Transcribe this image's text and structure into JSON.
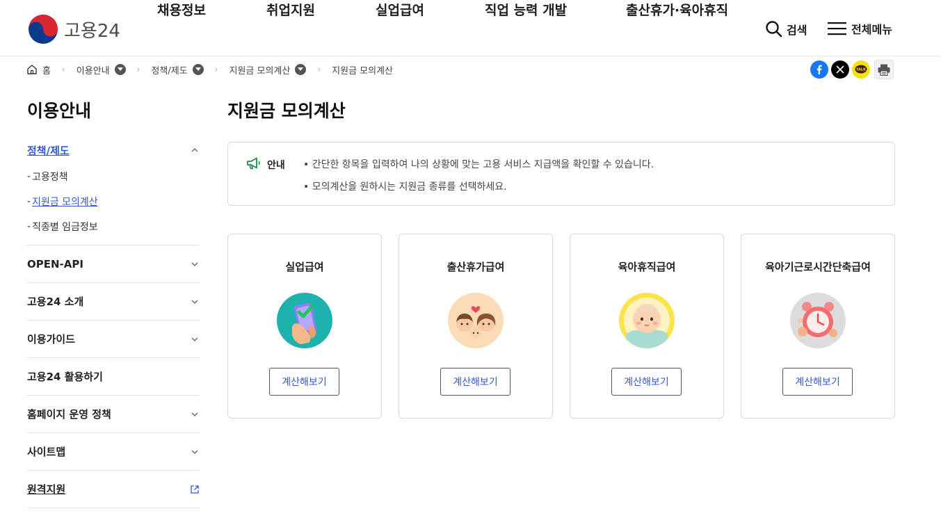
{
  "header": {
    "logo_text": "고용24",
    "nav": [
      "채용정보",
      "취업지원",
      "실업급여",
      "직업 능력 개발",
      "출산휴가·육아휴직"
    ],
    "search_label": "검색",
    "menu_label": "전체메뉴"
  },
  "breadcrumb": {
    "home": "홈",
    "items": [
      "이용안내",
      "정책/제도",
      "지원금 모의계산",
      "지원금 모의계산"
    ]
  },
  "share": {
    "icons": [
      "facebook-icon",
      "x-icon",
      "kakaotalk-icon",
      "print-icon"
    ],
    "kakao_text": "TALK"
  },
  "sidebar": {
    "title": "이용안내",
    "groups": [
      {
        "label": "정책/제도",
        "expanded": true,
        "sub": [
          "고용정책",
          "지원금 모의계산",
          "직종별 임금정보"
        ],
        "active_sub": 1
      },
      {
        "label": "OPEN-API"
      },
      {
        "label": "고용24 소개"
      },
      {
        "label": "이용가이드"
      },
      {
        "label": "고용24 활용하기"
      },
      {
        "label": "홈페이지 운영 정책"
      },
      {
        "label": "사이트맵"
      },
      {
        "label": "원격지원"
      }
    ]
  },
  "main": {
    "title": "지원금 모의계산",
    "notice": {
      "label": "안내",
      "lines": [
        "• 간단한 항목을 입력하여 나의 상황에 맞는 고용 서비스 지급액을 확인할 수 있습니다.",
        "• 모의계산을 원하시는 지원금 종류를 선택하세요."
      ]
    },
    "cards": [
      {
        "title": "실업급여",
        "button": "계산해보기",
        "icon": "phone-check-icon"
      },
      {
        "title": "출산휴가급여",
        "button": "계산해보기",
        "icon": "family-icon"
      },
      {
        "title": "육아휴직급여",
        "button": "계산해보기",
        "icon": "baby-icon"
      },
      {
        "title": "육아기근로시간단축급여",
        "button": "계산해보기",
        "icon": "alarm-clock-icon"
      }
    ]
  },
  "colors": {
    "accent": "#3457d5",
    "facebook": "#1877f2",
    "x": "#000000",
    "kakao": "#fae100"
  }
}
